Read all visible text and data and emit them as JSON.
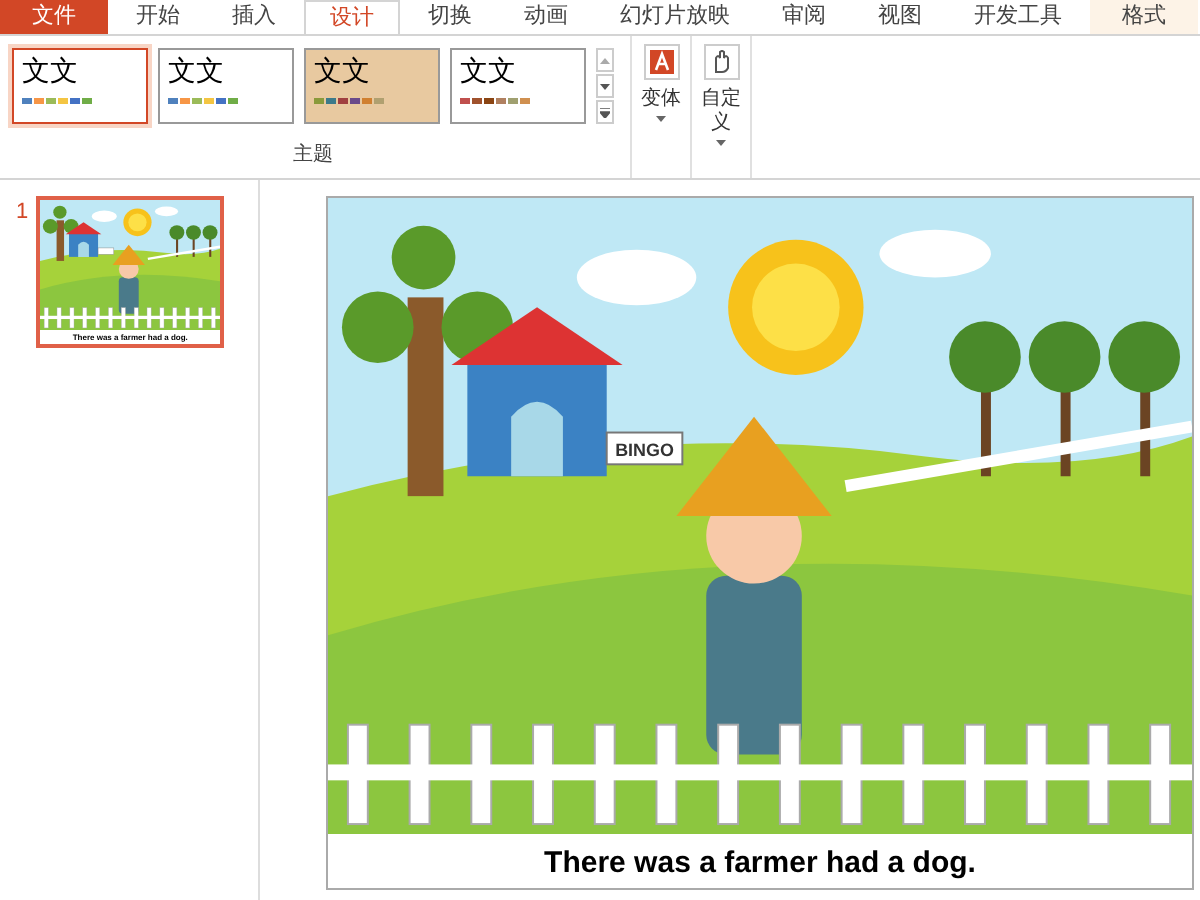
{
  "tabs": [
    {
      "label": "文件",
      "kind": "file",
      "selected": false
    },
    {
      "label": "开始",
      "kind": "tab",
      "selected": false
    },
    {
      "label": "插入",
      "kind": "tab",
      "selected": false
    },
    {
      "label": "设计",
      "kind": "tab",
      "selected": true
    },
    {
      "label": "切换",
      "kind": "tab",
      "selected": false
    },
    {
      "label": "动画",
      "kind": "tab",
      "selected": false
    },
    {
      "label": "幻灯片放映",
      "kind": "tab",
      "selected": false
    },
    {
      "label": "审阅",
      "kind": "tab",
      "selected": false
    },
    {
      "label": "视图",
      "kind": "tab",
      "selected": false
    },
    {
      "label": "开发工具",
      "kind": "tab",
      "selected": false
    },
    {
      "label": "格式",
      "kind": "context",
      "selected": false
    }
  ],
  "themes": {
    "label": "主题",
    "items": [
      {
        "label": "文文",
        "kind": "plain",
        "selected": true
      },
      {
        "label": "文文",
        "kind": "plain",
        "selected": false
      },
      {
        "label": "文文",
        "kind": "wood",
        "selected": false
      },
      {
        "label": "文文",
        "kind": "banded",
        "selected": false
      }
    ]
  },
  "ribbon_buttons": [
    {
      "label": "变体",
      "kind": "variant"
    },
    {
      "label": "自定义",
      "kind": "custom"
    }
  ],
  "slides": [
    {
      "number": "1",
      "selected": true,
      "caption": "There was a farmer had a dog."
    }
  ],
  "slide": {
    "sign": "BINGO",
    "caption": "There was a farmer had a dog."
  }
}
